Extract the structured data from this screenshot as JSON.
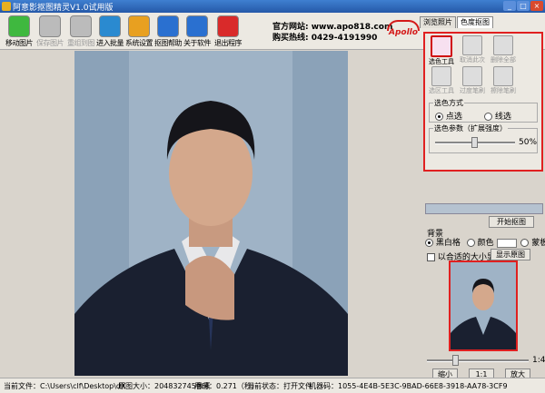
{
  "window": {
    "title": "阿意影抠图精灵V1.0试用版",
    "minimize": "_",
    "maximize": "□",
    "close": "×"
  },
  "toolbar": {
    "buttons": [
      {
        "label": "移动图片"
      },
      {
        "label": "保存图片"
      },
      {
        "label": "重组到图"
      },
      {
        "label": "进入批量"
      },
      {
        "label": "系统设置"
      },
      {
        "label": "抠图帮助"
      },
      {
        "label": "关于软件"
      },
      {
        "label": "退出程序"
      }
    ]
  },
  "header": {
    "site": "官方网站: www.apo818.com",
    "hotline": "购买热线: 0429-4191990",
    "logo": "Apollo"
  },
  "tabs": [
    {
      "label": "浏览照片"
    },
    {
      "label": "色度抠图"
    }
  ],
  "tools": [
    {
      "label": "选色工具"
    },
    {
      "label": "取消此次"
    },
    {
      "label": "删除全部"
    },
    {
      "label": "选区工具"
    },
    {
      "label": "过度笔刷"
    },
    {
      "label": "擦除笔刷"
    }
  ],
  "color_mode": {
    "legend": "选色方式",
    "opt1": "点选",
    "opt2": "线选"
  },
  "color_param": {
    "legend": "选色参数（扩展强度）",
    "value": "50%"
  },
  "start_btn": "开始抠图",
  "background": {
    "legend": "背景",
    "opt1": "黑白格",
    "opt2": "颜色",
    "opt3": "蒙板"
  },
  "fit_label": "以合适的大小显示",
  "show_original": "显示原图",
  "zoom": {
    "label": "1:4",
    "out": "缩小",
    "ratio": "1:1",
    "in": "放大"
  },
  "status": {
    "file": "当前文件：C:\\Users\\clf\\Desktop\\dX",
    "size": "原图大小：204832745像素",
    "time": "用时：0.271（秒）",
    "state": "当前状态：打开文件",
    "machine": "机器码：1055-4E4B-5E3C-9BAD-66E8-3918-AA78-3CF9"
  },
  "colors": {
    "accent_red": "#e02020",
    "title_bar": "#2f6cc0"
  }
}
